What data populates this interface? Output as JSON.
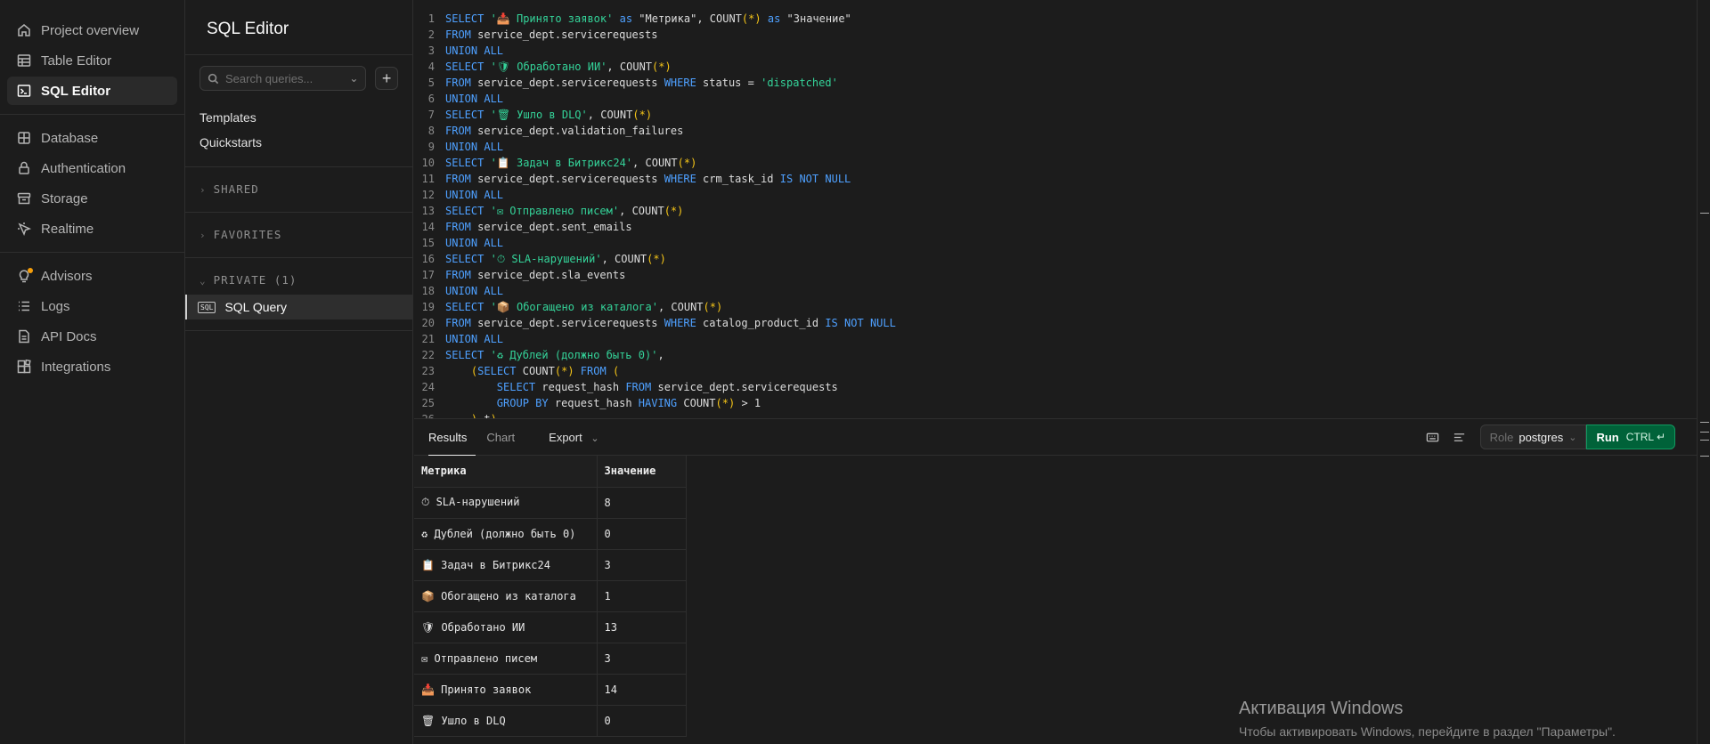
{
  "nav": {
    "items": [
      {
        "label": "Project overview",
        "icon": "home-icon"
      },
      {
        "label": "Table Editor",
        "icon": "table-icon"
      },
      {
        "label": "SQL Editor",
        "icon": "terminal-icon",
        "active": true
      },
      {
        "label": "Database",
        "icon": "database-icon"
      },
      {
        "label": "Authentication",
        "icon": "lock-icon"
      },
      {
        "label": "Storage",
        "icon": "archive-icon"
      },
      {
        "label": "Realtime",
        "icon": "cursor-icon"
      },
      {
        "label": "Advisors",
        "icon": "lightbulb-icon"
      },
      {
        "label": "Logs",
        "icon": "list-icon"
      },
      {
        "label": "API Docs",
        "icon": "file-icon"
      },
      {
        "label": "Integrations",
        "icon": "blocks-icon"
      }
    ]
  },
  "query_panel": {
    "title": "SQL Editor",
    "search_placeholder": "Search queries...",
    "templates": "Templates",
    "quickstarts": "Quickstarts",
    "section_shared": "SHARED",
    "section_favorites": "FAVORITES",
    "section_private": "PRIVATE (1)",
    "query_label": "SQL Query",
    "sql_badge": "SQL"
  },
  "editor": {
    "lines": [
      "SELECT '📥 Принято заявок' as \"Метрика\", COUNT(*) as \"Значение\"",
      "FROM service_dept.servicerequests",
      "UNION ALL",
      "SELECT '🛡 Обработано ИИ', COUNT(*)",
      "FROM service_dept.servicerequests WHERE status = 'dispatched'",
      "UNION ALL",
      "SELECT '🗑 Ушло в DLQ', COUNT(*)",
      "FROM service_dept.validation_failures",
      "UNION ALL",
      "SELECT '📋 Задач в Битрикс24', COUNT(*)",
      "FROM service_dept.servicerequests WHERE crm_task_id IS NOT NULL",
      "UNION ALL",
      "SELECT '✉ Отправлено писем', COUNT(*)",
      "FROM service_dept.sent_emails",
      "UNION ALL",
      "SELECT '⏱ SLA-нарушений', COUNT(*)",
      "FROM service_dept.sla_events",
      "UNION ALL",
      "SELECT '📦 Обогащено из каталога', COUNT(*)",
      "FROM service_dept.servicerequests WHERE catalog_product_id IS NOT NULL",
      "UNION ALL",
      "SELECT '♻ Дублей (должно быть 0)',",
      "    (SELECT COUNT(*) FROM (",
      "        SELECT request_hash FROM service_dept.servicerequests",
      "        GROUP BY request_hash HAVING COUNT(*) > 1",
      "    ) t)"
    ]
  },
  "results_toolbar": {
    "tab_results": "Results",
    "tab_chart": "Chart",
    "export": "Export",
    "role_label": "Role",
    "role_value": "postgres",
    "run_label": "Run",
    "run_shortcut": "CTRL ↵"
  },
  "results": {
    "columns": [
      "Метрика",
      "Значение"
    ],
    "rows": [
      [
        "⏱ SLA-нарушений",
        "8"
      ],
      [
        "♻ Дублей (должно быть 0)",
        "0"
      ],
      [
        "📋 Задач в Битрикс24",
        "3"
      ],
      [
        "📦 Обогащено из каталога",
        "1"
      ],
      [
        "🛡 Обработано ИИ",
        "13"
      ],
      [
        "✉ Отправлено писем",
        "3"
      ],
      [
        "📥 Принято заявок",
        "14"
      ],
      [
        "🗑 Ушло в DLQ",
        "0"
      ]
    ]
  },
  "watermark": {
    "title": "Активация Windows",
    "subtitle": "Чтобы активировать Windows, перейдите в раздел \"Параметры\"."
  }
}
